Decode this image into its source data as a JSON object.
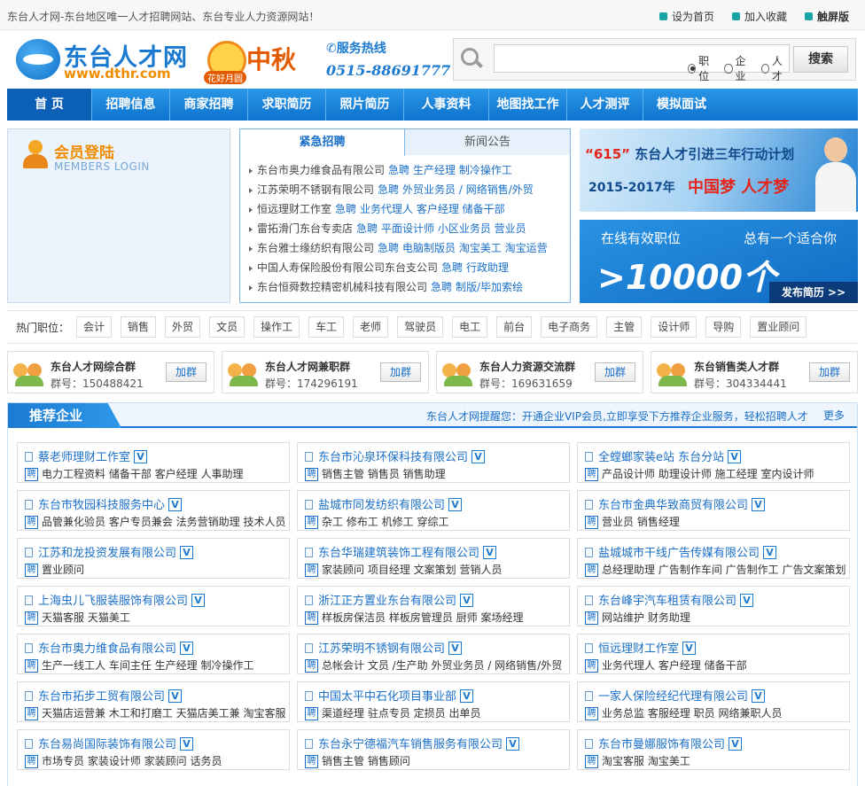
{
  "topbar": {
    "welcome": "东台人才网-东台地区唯一人才招聘网站、东台专业人力资源网站！",
    "links": [
      {
        "label": "设为首页",
        "color": "#1aa3a3"
      },
      {
        "label": "加入收藏",
        "color": "#1aa3a3"
      },
      {
        "label": "触屏版",
        "color": "#e2001a"
      }
    ]
  },
  "header": {
    "logo_name": "东台人才网",
    "logo_url": "www.dthr.com",
    "festival_text": "中秋",
    "festival_sub": "花好月圆",
    "hotline_label": "✆服务热线",
    "hotline_number": "0515-88691777"
  },
  "search": {
    "placeholder": "",
    "options": [
      "职位",
      "企业",
      "人才"
    ],
    "selected": "职位",
    "button": "搜索"
  },
  "nav": [
    "首 页",
    "招聘信息",
    "商家招聘",
    "求职简历",
    "照片简历",
    "人事资料",
    "地图找工作",
    "人才测评",
    "模拟面试"
  ],
  "login": {
    "title": "会员登陆",
    "subtitle": "MEMBERS LOGIN"
  },
  "jobs_panel": {
    "tabs": [
      "紧急招聘",
      "新闻公告"
    ],
    "urgent_label": "急聘",
    "rows": [
      {
        "company": "东台市奥力维食品有限公司",
        "positions": "生产经理  制冷操作工"
      },
      {
        "company": "江苏荣明不锈钢有限公司",
        "positions": "外贸业务员 / 网络销售/外贸"
      },
      {
        "company": "恒远理财工作室",
        "positions": "业务代理人  客户经理  储备干部"
      },
      {
        "company": "雷拓滑门东台专卖店",
        "positions": "平面设计师  小区业务员  营业员"
      },
      {
        "company": "东台雅士缘纺织有限公司",
        "positions": "电脑制版员  淘宝美工  淘宝运营"
      },
      {
        "company": "中国人寿保险股份有限公司东台支公司",
        "positions": "行政助理"
      },
      {
        "company": "东台恒舜数控精密机械科技有限公司",
        "positions": "制版/毕加索绘"
      }
    ]
  },
  "banner1": {
    "title_pre": "“615”",
    "title_post": "东台人才引进三年行动计划",
    "years": "2015-2017年",
    "dream": "中国梦 人才梦"
  },
  "banner2": {
    "left": "在线有效职位",
    "right": "总有一个适合你",
    "number": ">10000个",
    "button": "发布简历 >>"
  },
  "hot_jobs": {
    "label": "热门职位：",
    "tags": [
      "会计",
      "销售",
      "外贸",
      "文员",
      "操作工",
      "车工",
      "老师",
      "驾驶员",
      "电工",
      "前台",
      "电子商务",
      "主管",
      "设计师",
      "导购",
      "置业顾问"
    ]
  },
  "qq_groups": [
    {
      "name": "东台人才网综合群",
      "number": "群号：150488421",
      "button": "加群"
    },
    {
      "name": "东台人才网兼职群",
      "number": "群号：174296191",
      "button": "加群"
    },
    {
      "name": "东台人力资源交流群",
      "number": "群号：169631659",
      "button": "加群"
    },
    {
      "name": "东台销售类人才群",
      "number": "群号：304334441",
      "button": "加群"
    }
  ],
  "recommended": {
    "title": "推荐企业",
    "note": "东台人才网提醒您：开通企业VIP会员,立即享受下方推荐企业服务，轻松招聘人才",
    "more": "更多",
    "verified_mark": "V",
    "pin_mark": "聘",
    "companies": [
      [
        {
          "name": "蔡老师理财工作室",
          "jobs": "电力工程资料  储备干部  客户经理  人事助理"
        },
        {
          "name": "东台市沁泉环保科技有限公司",
          "jobs": "销售主管  销售员  销售助理"
        },
        {
          "name": "全螳螂家装e站 东台分站",
          "jobs": "产品设计师  助理设计师  施工经理  室内设计师"
        }
      ],
      [
        {
          "name": "东台市牧园科技服务中心",
          "jobs": "品管兼化验员  客户专员兼会  法务营销助理  技术人员"
        },
        {
          "name": "盐城市同发纺织有限公司",
          "jobs": "杂工  修布工  机修工  穿综工"
        },
        {
          "name": "东台市金典华致商贸有限公司",
          "jobs": "营业员  销售经理"
        }
      ],
      [
        {
          "name": "江苏和龙投资发展有限公司",
          "jobs": "置业顾问"
        },
        {
          "name": "东台华瑞建筑装饰工程有限公司",
          "jobs": "家装顾问  项目经理  文案策划  营销人员"
        },
        {
          "name": "盐城城市干线广告传媒有限公司",
          "jobs": "总经理助理  广告制作车间  广告制作工  广告文案策划"
        }
      ],
      [
        {
          "name": "上海虫儿飞服装服饰有限公司",
          "jobs": "天猫客服  天猫美工"
        },
        {
          "name": "浙江正方置业东台有限公司",
          "jobs": "样板房保洁员  样板房管理员  厨师  案场经理"
        },
        {
          "name": "东台峰宇汽车租赁有限公司",
          "jobs": "网站维护  财务助理"
        }
      ],
      [
        {
          "name": "东台市奥力维食品有限公司",
          "jobs": "生产一线工人  车间主任  生产经理  制冷操作工"
        },
        {
          "name": "江苏荣明不锈钢有限公司",
          "jobs": "总帐会计  文员  /生产助  外贸业务员 / 网络销售/外贸"
        },
        {
          "name": "恒远理财工作室",
          "jobs": "业务代理人  客户经理  储备干部"
        }
      ],
      [
        {
          "name": "东台市拓步工贸有限公司",
          "jobs": "天猫店运营兼  木工和打磨工  天猫店美工兼  淘宝客服"
        },
        {
          "name": "中国太平中石化项目事业部",
          "jobs": "渠道经理  驻点专员  定损员  出单员"
        },
        {
          "name": "一家人保险经纪代理有限公司",
          "jobs": "业务总监  客服经理  职员  网络兼职人员"
        }
      ],
      [
        {
          "name": "东台易尚国际装饰有限公司",
          "jobs": "市场专员  家装设计师  家装顾问  话务员"
        },
        {
          "name": "东台永宁德福汽车销售服务有限公司",
          "jobs": "销售主管  销售顾问"
        },
        {
          "name": "东台市曼娜服饰有限公司",
          "jobs": "淘宝客服  淘宝美工"
        }
      ]
    ]
  }
}
